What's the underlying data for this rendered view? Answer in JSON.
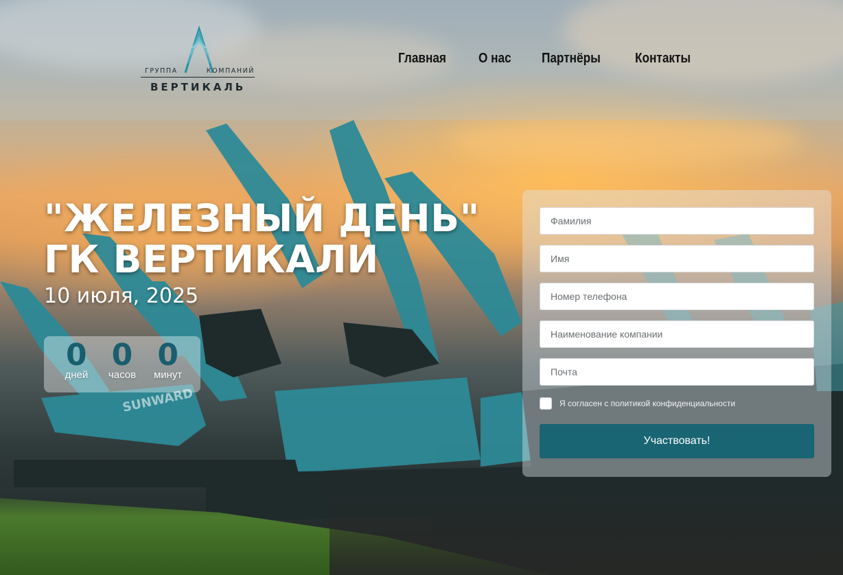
{
  "logo": {
    "top_left": "ГРУППА",
    "top_right": "КОМПАНИЙ",
    "name": "ВЕРТИКАЛЬ",
    "icon": "vertical-arrow-logo-icon"
  },
  "nav": {
    "items": [
      {
        "label": "Главная"
      },
      {
        "label": "О нас"
      },
      {
        "label": "Партнёры"
      },
      {
        "label": "Контакты"
      }
    ]
  },
  "event": {
    "title_line1": "\"ЖЕЛЕЗНЫЙ ДЕНЬ\"",
    "title_line2": "ГК ВЕРТИКАЛИ",
    "date": "10 июля, 2025"
  },
  "countdown": {
    "days": {
      "value": "0",
      "label": "дней"
    },
    "hours": {
      "value": "0",
      "label": "часов"
    },
    "minutes": {
      "value": "0",
      "label": "минут"
    }
  },
  "form": {
    "last_name_placeholder": "Фамилия",
    "first_name_placeholder": "Имя",
    "phone_placeholder": "Номер телефона",
    "company_placeholder": "Наименование компании",
    "email_placeholder": "Почта",
    "consent_label": "Я согласен с политикой конфиденциальности",
    "consent_checked": false,
    "submit_label": "Участвовать!"
  },
  "colors": {
    "accent": "#196573",
    "countdown_number": "#1a5e6e",
    "nav_text": "#121212"
  }
}
